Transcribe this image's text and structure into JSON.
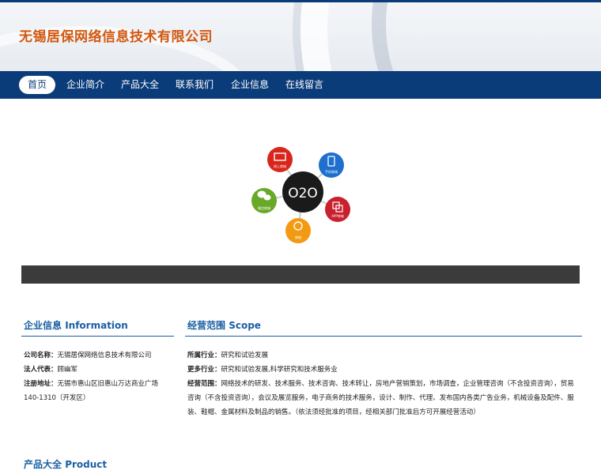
{
  "site": {
    "title": "无锡居保网络信息技术有限公司"
  },
  "nav": {
    "items": [
      {
        "label": "首页",
        "active": true
      },
      {
        "label": "企业简介"
      },
      {
        "label": "产品大全"
      },
      {
        "label": "联系我们"
      },
      {
        "label": "企业信息"
      },
      {
        "label": "在线留言"
      }
    ]
  },
  "banner": {
    "center_label": "O2O",
    "nodes": [
      {
        "label": "线上商城",
        "color": "#d9261c",
        "icon": "monitor-icon"
      },
      {
        "label": "手机商城",
        "color": "#1e6fce",
        "icon": "phone-icon"
      },
      {
        "label": "APP商城",
        "color": "#c8202c",
        "icon": "app-icon"
      },
      {
        "label": "商城",
        "color": "#f29a12",
        "icon": "store-icon"
      },
      {
        "label": "微信商城",
        "color": "#6aa829",
        "icon": "wechat-icon"
      }
    ]
  },
  "company": {
    "heading_cn": "企业信息",
    "heading_en": "Information",
    "rows": [
      {
        "label": "公司名称：",
        "value": "无锡居保网络信息技术有限公司"
      },
      {
        "label": "法人代表：",
        "value": "顾幽军"
      },
      {
        "label": "注册地址：",
        "value": "无锡市惠山区旧惠山万达商业广场140-1310（开发区）"
      }
    ]
  },
  "scope": {
    "heading_cn": "经营范围",
    "heading_en": "Scope",
    "rows": [
      {
        "label": "所属行业：",
        "value": "研究和试验发展"
      },
      {
        "label": "更多行业：",
        "value": "研究和试验发展,科学研究和技术服务业"
      },
      {
        "label": "经营范围：",
        "value": "网络技术的研发、技术服务、技术咨询、技术转让，房地产营销策划，市场调查，企业管理咨询（不含投资咨询），贸易咨询（不含投资咨询），会议及展览服务，电子商务的技术服务，设计、制作、代理、发布国内各类广告业务，机械设备及配件、服装、鞋帽、金属材料及制品的销售。（依法须经批准的项目，经相关部门批准后方可开展经营活动）"
      }
    ]
  },
  "product": {
    "heading_cn": "产品大全",
    "heading_en": "Product"
  },
  "colors": {
    "nav": "#0b3c7a",
    "title": "#d2580f",
    "section": "#1a5fa3"
  }
}
